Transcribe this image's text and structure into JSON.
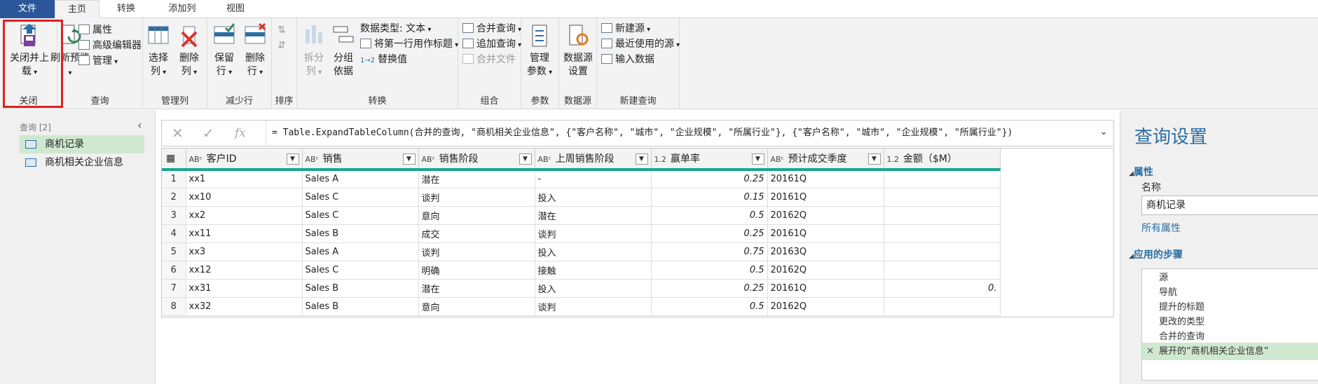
{
  "tabs": [
    "文件",
    "主页",
    "转换",
    "添加列",
    "视图"
  ],
  "ribbon": {
    "close": {
      "btn": "关闭并上载",
      "group": "关闭"
    },
    "query": {
      "refresh": "刷新预览",
      "props": "属性",
      "adv": "高级编辑器",
      "manage": "管理",
      "group": "查询"
    },
    "cols": {
      "choose": "选择列",
      "remove": "删除列",
      "group": "管理列"
    },
    "rows": {
      "keep": "保留行",
      "remove": "删除行",
      "group": "减少行"
    },
    "sort": {
      "group": "排序"
    },
    "transform": {
      "split": "拆分列",
      "groupby": "分组依据",
      "dtype": "数据类型: 文本",
      "firstrow": "将第一行用作标题",
      "replace": "替换值",
      "group": "转换"
    },
    "combine": {
      "merge": "合并查询",
      "append": "追加查询",
      "files": "合并文件",
      "group": "组合"
    },
    "params": {
      "manage": "管理参数",
      "group": "参数"
    },
    "ds": {
      "settings": "数据源设置",
      "group": "数据源"
    },
    "newq": {
      "newsrc": "新建源",
      "recent": "最近使用的源",
      "enter": "输入数据",
      "group": "新建查询"
    }
  },
  "nav": {
    "header": "查询 [2]",
    "items": [
      "商机记录",
      "商机相关企业信息"
    ]
  },
  "formula": {
    "prefix": "= ",
    "text": "Table.ExpandTableColumn(合并的查询, \"商机相关企业信息\", {\"客户名称\", \"城市\", \"企业规模\", \"所属行业\"}, {\"客户名称\", \"城市\", \"企业规模\", \"所属行业\"})"
  },
  "table": {
    "columns": [
      {
        "type": "ABᶜ",
        "name": "客户ID"
      },
      {
        "type": "ABᶜ",
        "name": "销售"
      },
      {
        "type": "ABᶜ",
        "name": "销售阶段"
      },
      {
        "type": "ABᶜ",
        "name": "上周销售阶段"
      },
      {
        "type": "1.2",
        "name": "赢单率"
      },
      {
        "type": "ABᶜ",
        "name": "预计成交季度"
      },
      {
        "type": "1.2",
        "name": "金额（$M）"
      }
    ],
    "rows": [
      [
        "1",
        "xx1",
        "Sales A",
        "潜在",
        "-",
        "0.25",
        "20161Q",
        ""
      ],
      [
        "2",
        "xx10",
        "Sales C",
        "谈判",
        "投入",
        "0.15",
        "20161Q",
        ""
      ],
      [
        "3",
        "xx2",
        "Sales C",
        "意向",
        "潜在",
        "0.5",
        "20162Q",
        ""
      ],
      [
        "4",
        "xx11",
        "Sales B",
        "成交",
        "谈判",
        "0.25",
        "20161Q",
        ""
      ],
      [
        "5",
        "xx3",
        "Sales A",
        "谈判",
        "投入",
        "0.75",
        "20163Q",
        ""
      ],
      [
        "6",
        "xx12",
        "Sales C",
        "明确",
        "接触",
        "0.5",
        "20162Q",
        ""
      ],
      [
        "7",
        "xx31",
        "Sales B",
        "潜在",
        "投入",
        "0.25",
        "20161Q",
        "0."
      ],
      [
        "8",
        "xx32",
        "Sales B",
        "意向",
        "谈判",
        "0.5",
        "20162Q",
        ""
      ]
    ]
  },
  "settings": {
    "title": "查询设置",
    "props": "属性",
    "name_label": "名称",
    "name_value": "商机记录",
    "all_props": "所有属性",
    "steps_title": "应用的步骤",
    "steps": [
      "源",
      "导航",
      "提升的标题",
      "更改的类型",
      "合并的查询",
      "展开的“商机相关企业信息”"
    ]
  }
}
